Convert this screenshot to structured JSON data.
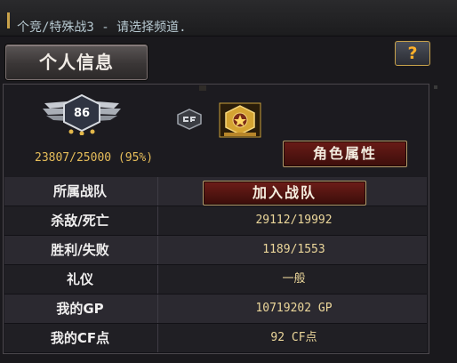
{
  "topbar": {
    "channel_text": "个竞/特殊战3 - 请选择频道."
  },
  "profile_button": {
    "label": "个人信息"
  },
  "help_button": {
    "label": "?"
  },
  "player": {
    "rank_level": "86",
    "exp_text": "23807/25000 (95%)"
  },
  "attr_button": {
    "label": "角色属性"
  },
  "stats": {
    "rows": [
      {
        "label": "所属战队",
        "value": ""
      },
      {
        "label": "杀敌/死亡",
        "value": "29112/19992"
      },
      {
        "label": "胜利/失败",
        "value": "1189/1553"
      },
      {
        "label": "礼仪",
        "value": "一般"
      },
      {
        "label": "我的GP",
        "value": "10719202 GP"
      },
      {
        "label": "我的CF点",
        "value": "92 CF点"
      }
    ],
    "join_button_label": "加入战队"
  },
  "icons": {
    "rank_badge": "rank-wings-badge-icon",
    "cf_logo": "cf-logo-icon",
    "medal": "gold-medal-icon"
  },
  "colors": {
    "exp_text": "#e6bd5a",
    "value_text": "#ecd79b",
    "button_red": "#6a1b17",
    "help_accent": "#ffb02a"
  }
}
